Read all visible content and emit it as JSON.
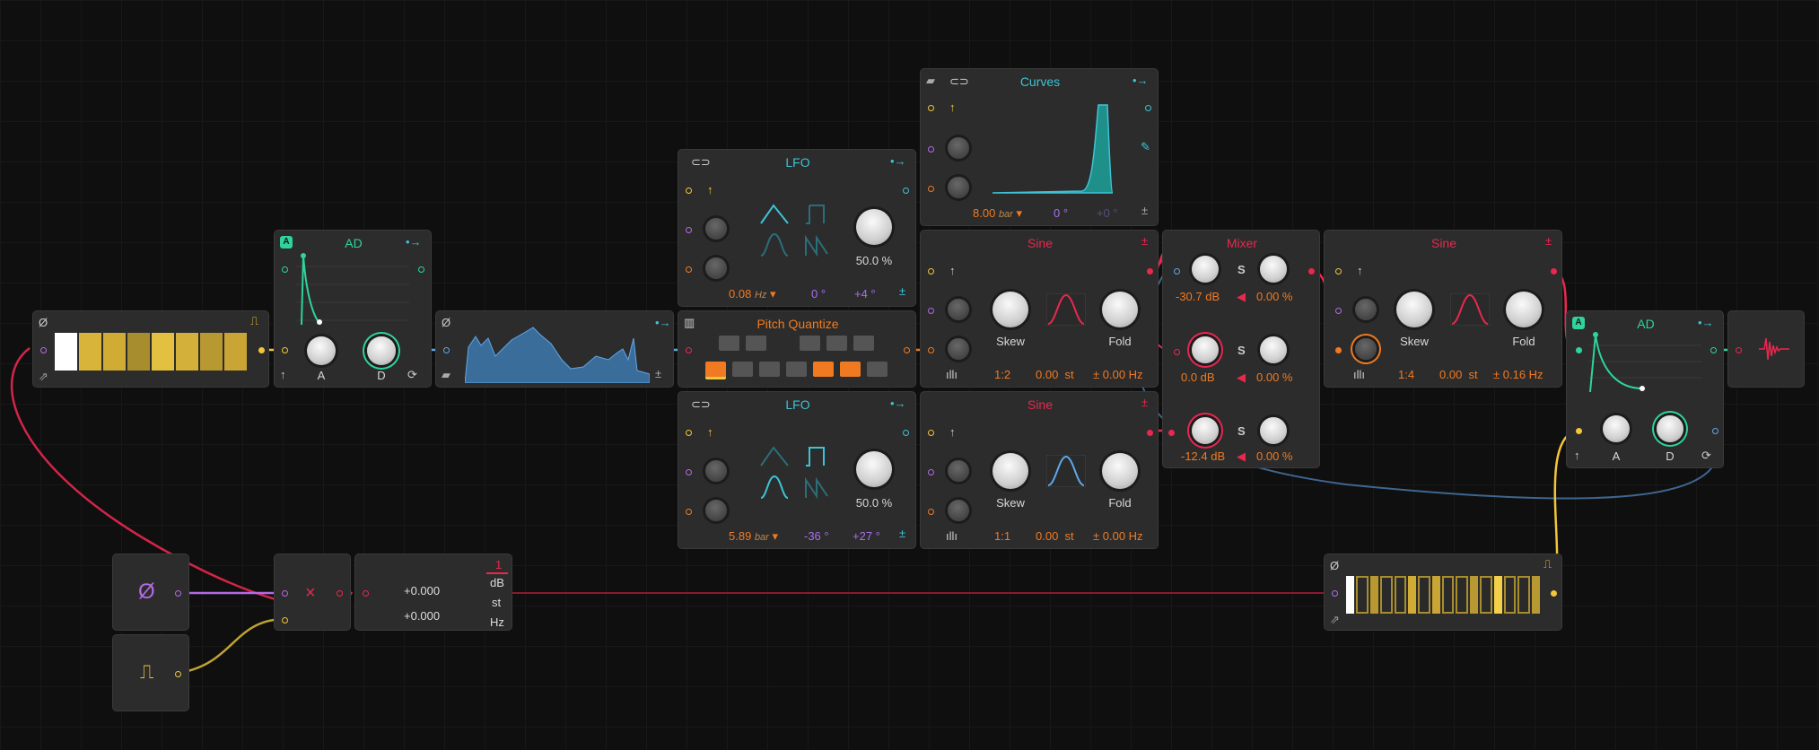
{
  "colors": {
    "cyan": "#3ec3d6",
    "red": "#e8284f",
    "green": "#2ed49a",
    "orange": "#f07a22",
    "yellow": "#f2c53b",
    "magenta": "#b569e6",
    "blue": "#5fa7e8"
  },
  "ad1": {
    "title": "AD",
    "badge": "A",
    "knob_a": "A",
    "knob_d": "D"
  },
  "ad2": {
    "title": "AD",
    "badge": "A",
    "knob_a": "A",
    "knob_d": "D"
  },
  "lfo1": {
    "title": "LFO",
    "rate": "0.08",
    "rate_unit": "Hz",
    "phase": "0 °",
    "offset": "+4 °",
    "amount": "50.0 %"
  },
  "lfo2": {
    "title": "LFO",
    "rate": "5.89",
    "rate_unit": "bar",
    "phase": "-36 °",
    "offset": "+27 °",
    "amount": "50.0 %"
  },
  "curves": {
    "title": "Curves",
    "rate": "8.00",
    "rate_unit": "bar",
    "phase": "0 °",
    "offset": "+0 °"
  },
  "pitch_quantize": {
    "title": "Pitch Quantize"
  },
  "sine1": {
    "title": "Sine",
    "skew": "Skew",
    "fold": "Fold",
    "ratio": "1:2",
    "offset_val": "0.00",
    "offset_unit": "st",
    "hz": "± 0.00 Hz"
  },
  "sine2": {
    "title": "Sine",
    "skew": "Skew",
    "fold": "Fold",
    "ratio": "1:1",
    "offset_val": "0.00",
    "offset_unit": "st",
    "hz": "± 0.00 Hz"
  },
  "sine3": {
    "title": "Sine",
    "skew": "Skew",
    "fold": "Fold",
    "ratio": "1:4",
    "offset_val": "0.00",
    "offset_unit": "st",
    "hz": "± 0.16 Hz"
  },
  "mixer": {
    "title": "Mixer",
    "rows": [
      {
        "level": "-30.7 dB",
        "s": "S",
        "pan": "0.00 %"
      },
      {
        "level": "0.0 dB",
        "s": "S",
        "pan": "0.00 %"
      },
      {
        "level": "-12.4 dB",
        "s": "S",
        "pan": "0.00 %"
      }
    ]
  },
  "constant": {
    "val1": "+0.000",
    "val2": "+0.000",
    "badge": "1",
    "units": [
      "dB",
      "st",
      "Hz"
    ]
  },
  "multiply": {
    "symbol": "×"
  },
  "note_in": {
    "symbol": "Ø"
  },
  "gate_in": {
    "symbol": "⎍"
  }
}
